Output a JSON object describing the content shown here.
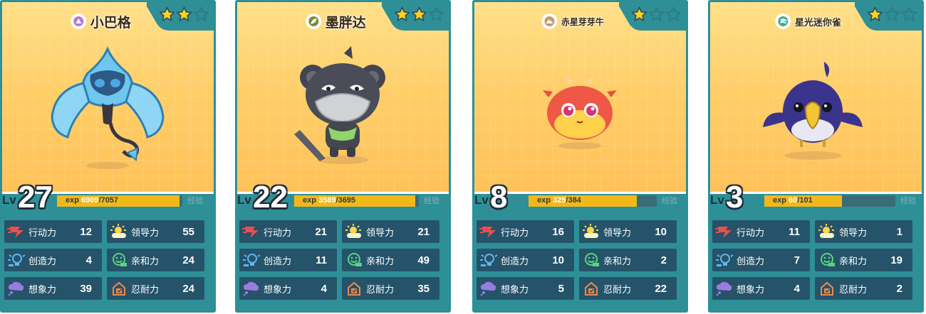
{
  "cards": [
    {
      "name": "小巴格",
      "element_icon": "rock-element-icon",
      "element_color": "#b47ad8",
      "stars_filled": 2,
      "stars_total": 3,
      "level_label": "Lv",
      "level": "27",
      "exp_label": "exp",
      "exp_current": "6909",
      "exp_total": "/7057",
      "exp_fraction": 0.979,
      "shop_label": "经验",
      "monster_icon": "blue-ghost-monster-icon",
      "stats": [
        {
          "label": "行动力",
          "value": "12",
          "icon": "speed-icon"
        },
        {
          "label": "领导力",
          "value": "55",
          "icon": "sun-cloud-icon"
        },
        {
          "label": "创造力",
          "value": "4",
          "icon": "lightbulb-icon"
        },
        {
          "label": "亲和力",
          "value": "24",
          "icon": "smile-face-icon"
        },
        {
          "label": "想象力",
          "value": "39",
          "icon": "thought-cloud-icon"
        },
        {
          "label": "忍耐力",
          "value": "24",
          "icon": "shield-box-icon"
        }
      ]
    },
    {
      "name": "墨胖达",
      "element_icon": "leaf-element-icon",
      "element_color": "#7a8c3a",
      "stars_filled": 2,
      "stars_total": 3,
      "level_label": "Lv",
      "level": "22",
      "exp_label": "exp",
      "exp_current": "3589",
      "exp_total": "/3695",
      "exp_fraction": 0.971,
      "shop_label": "经验",
      "monster_icon": "panda-monster-icon",
      "stats": [
        {
          "label": "行动力",
          "value": "21",
          "icon": "speed-icon"
        },
        {
          "label": "领导力",
          "value": "21",
          "icon": "sun-cloud-icon"
        },
        {
          "label": "创造力",
          "value": "11",
          "icon": "lightbulb-icon"
        },
        {
          "label": "亲和力",
          "value": "49",
          "icon": "smile-face-icon"
        },
        {
          "label": "想象力",
          "value": "4",
          "icon": "thought-cloud-icon"
        },
        {
          "label": "忍耐力",
          "value": "35",
          "icon": "shield-box-icon"
        }
      ]
    },
    {
      "name": "赤星芽芽牛",
      "element_icon": "mountain-element-icon",
      "element_color": "#c29a70",
      "stars_filled": 1,
      "stars_total": 3,
      "level_label": "Lv",
      "level": "8",
      "exp_label": "exp",
      "exp_current": "325",
      "exp_total": "/384",
      "exp_fraction": 0.846,
      "shop_label": "经验",
      "monster_icon": "red-calf-monster-icon",
      "stats": [
        {
          "label": "行动力",
          "value": "16",
          "icon": "speed-icon"
        },
        {
          "label": "领导力",
          "value": "10",
          "icon": "sun-cloud-icon"
        },
        {
          "label": "创造力",
          "value": "10",
          "icon": "lightbulb-icon"
        },
        {
          "label": "亲和力",
          "value": "2",
          "icon": "smile-face-icon"
        },
        {
          "label": "想象力",
          "value": "5",
          "icon": "thought-cloud-icon"
        },
        {
          "label": "忍耐力",
          "value": "22",
          "icon": "shield-box-icon"
        }
      ]
    },
    {
      "name": "星光迷你雀",
      "element_icon": "wind-element-icon",
      "element_color": "#3ab08a",
      "stars_filled": 1,
      "stars_total": 3,
      "level_label": "Lv",
      "level": "3",
      "exp_label": "exp",
      "exp_current": "60",
      "exp_total": "/101",
      "exp_fraction": 0.594,
      "shop_label": "经验",
      "monster_icon": "purple-bird-monster-icon",
      "stats": [
        {
          "label": "行动力",
          "value": "11",
          "icon": "speed-icon"
        },
        {
          "label": "领导力",
          "value": "1",
          "icon": "sun-cloud-icon"
        },
        {
          "label": "创造力",
          "value": "7",
          "icon": "lightbulb-icon"
        },
        {
          "label": "亲和力",
          "value": "19",
          "icon": "smile-face-icon"
        },
        {
          "label": "想象力",
          "value": "4",
          "icon": "thought-cloud-icon"
        },
        {
          "label": "忍耐力",
          "value": "2",
          "icon": "shield-box-icon"
        }
      ]
    }
  ]
}
